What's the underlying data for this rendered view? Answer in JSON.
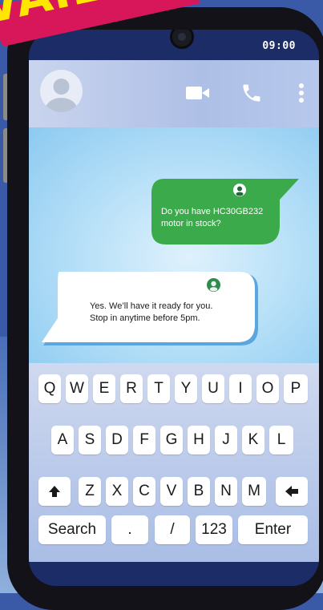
{
  "banner": {
    "text": "VAILABL"
  },
  "status": {
    "time": "09:00"
  },
  "header": {
    "avatar": "user-avatar-icon",
    "video": "video-call-icon",
    "call": "phone-icon",
    "menu": "more-vertical-icon"
  },
  "messages": {
    "sent": {
      "line1": "Do you have HC30GB232",
      "line2": "motor in stock?"
    },
    "received": {
      "line1": "Yes.  We’ll have it ready for you.",
      "line2": "Stop in anytime before 5pm."
    }
  },
  "keyboard": {
    "row1": [
      "Q",
      "W",
      "E",
      "R",
      "T",
      "Y",
      "U",
      "I",
      "O",
      "P"
    ],
    "row2": [
      "A",
      "S",
      "D",
      "F",
      "G",
      "H",
      "J",
      "K",
      "L"
    ],
    "row3": [
      "Z",
      "X",
      "C",
      "V",
      "B",
      "N",
      "M"
    ],
    "shift_icon": "shift-arrow-icon",
    "backspace_icon": "backspace-arrow-icon",
    "row4": [
      "Search",
      ".",
      "/",
      "123",
      "Enter"
    ]
  },
  "colors": {
    "sent_bubble": "#3aaa4a",
    "received_bubble": "#ffffff",
    "navy": "#1c2c66",
    "banner_red": "#d8175a",
    "banner_yellow": "#ffe600"
  }
}
